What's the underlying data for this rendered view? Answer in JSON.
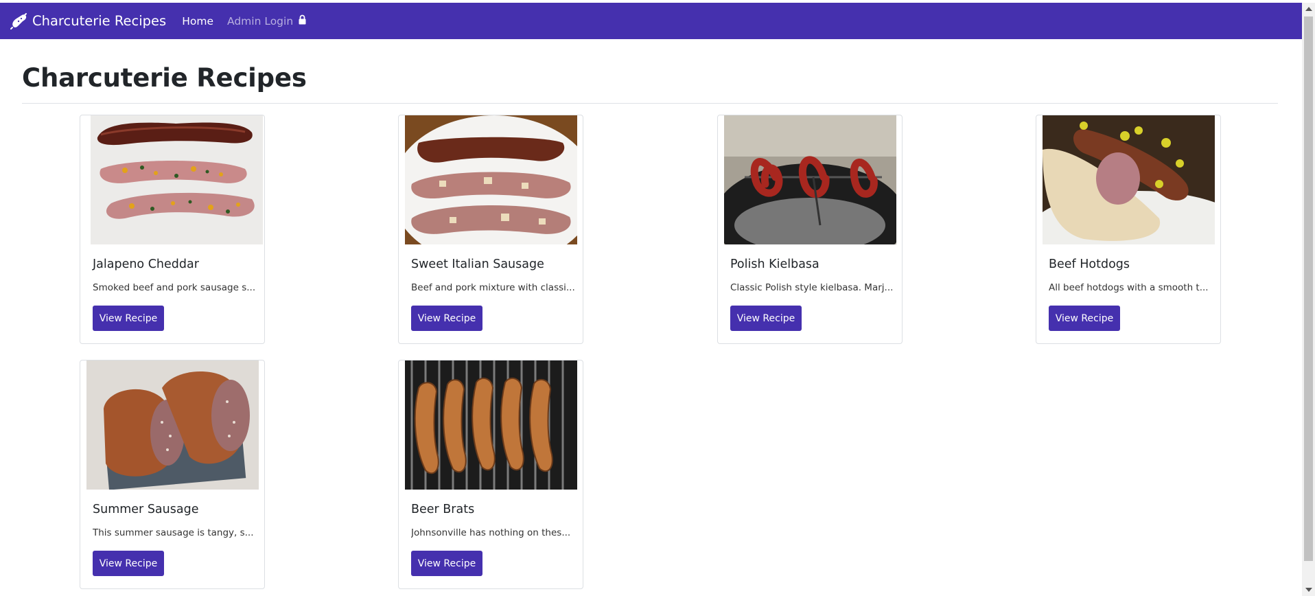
{
  "navbar": {
    "brand": "Charcuterie Recipes",
    "brand_icon": "sausage-icon",
    "home_label": "Home",
    "admin_label": "Admin Login",
    "admin_icon": "lock-icon"
  },
  "page": {
    "title": "Charcuterie Recipes"
  },
  "recipes": [
    {
      "title": "Jalapeno Cheddar",
      "description": "Smoked beef and pork sausage s...",
      "button": "View Recipe"
    },
    {
      "title": "Sweet Italian Sausage",
      "description": "Beef and pork mixture with classi...",
      "button": "View Recipe"
    },
    {
      "title": "Polish Kielbasa",
      "description": "Classic Polish style kielbasa. Marj...",
      "button": "View Recipe"
    },
    {
      "title": "Beef Hotdogs",
      "description": "All beef hotdogs with a smooth t...",
      "button": "View Recipe"
    },
    {
      "title": "Summer Sausage",
      "description": "This summer sausage is tangy, s...",
      "button": "View Recipe"
    },
    {
      "title": "Beer Brats",
      "description": "Johnsonville has nothing on thes...",
      "button": "View Recipe"
    }
  ],
  "colors": {
    "navbar": "#4530ae",
    "button": "#4530ae",
    "admin_link": "#b8b0e0"
  }
}
